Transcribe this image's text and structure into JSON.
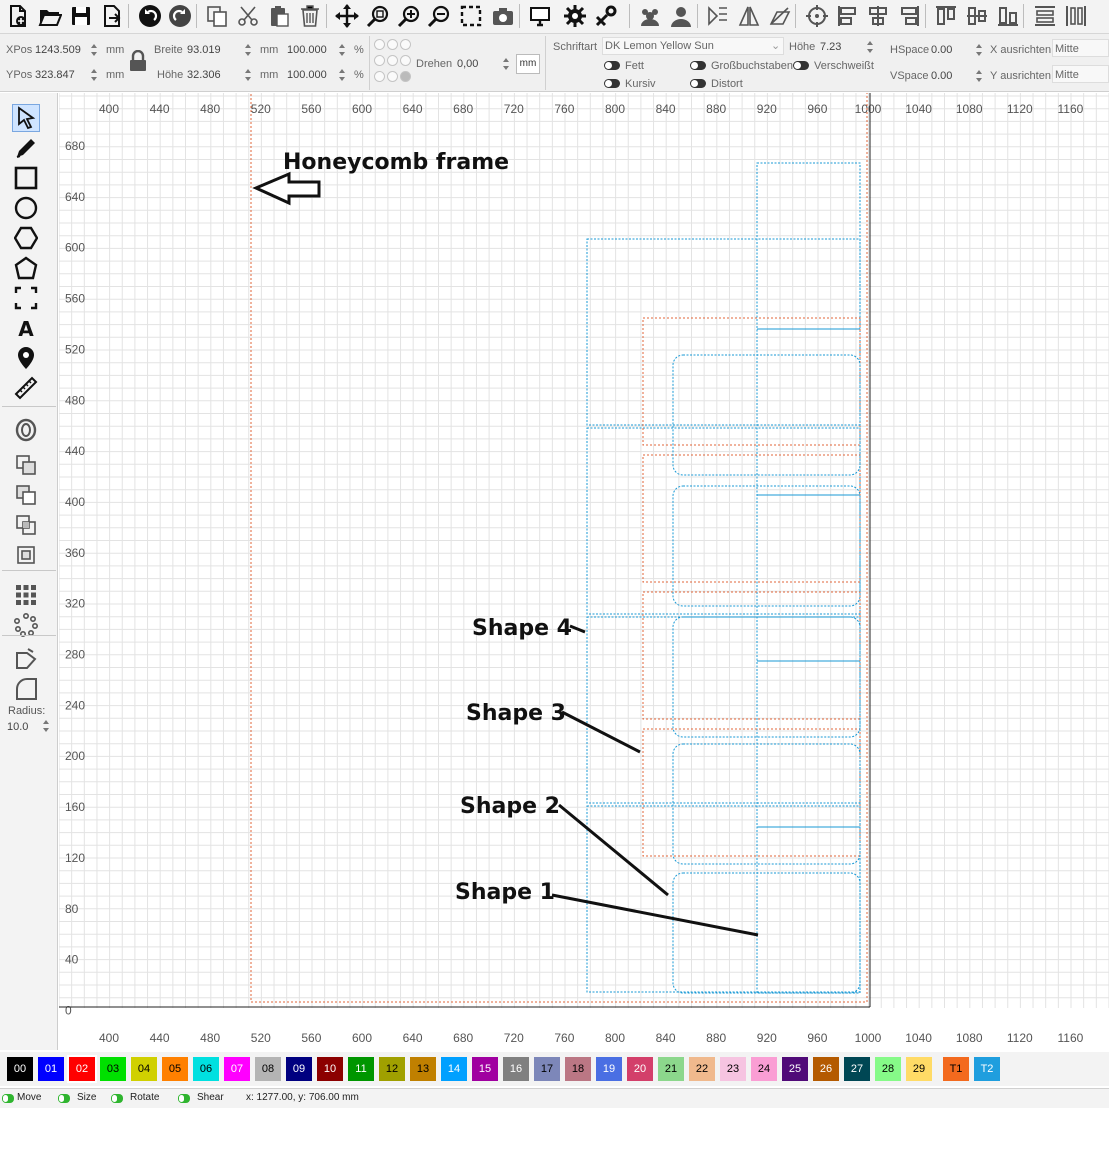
{
  "toolbar": {
    "buttons": [
      {
        "name": "new-file-icon"
      },
      {
        "name": "open-folder-icon"
      },
      {
        "name": "save-icon"
      },
      {
        "name": "export-icon"
      },
      {
        "name": "undo-icon"
      },
      {
        "name": "redo-icon"
      },
      {
        "name": "copy-icon"
      },
      {
        "name": "cut-icon"
      },
      {
        "name": "paste-icon"
      },
      {
        "name": "delete-icon"
      },
      {
        "name": "move-icon"
      },
      {
        "name": "zoom-fit-icon"
      },
      {
        "name": "zoom-in-icon"
      },
      {
        "name": "zoom-out-icon"
      },
      {
        "name": "zoom-selection-icon"
      },
      {
        "name": "camera-icon"
      },
      {
        "name": "monitor-icon"
      },
      {
        "name": "settings-icon"
      },
      {
        "name": "tools-icon"
      },
      {
        "name": "group-icon"
      },
      {
        "name": "ungroup-icon"
      },
      {
        "name": "mirror-horizontal-icon"
      },
      {
        "name": "mirror-vertical-icon"
      },
      {
        "name": "skew-icon"
      },
      {
        "name": "align-center-icon"
      },
      {
        "name": "align-left-icon"
      },
      {
        "name": "align-hcenter-icon"
      },
      {
        "name": "align-right-icon"
      },
      {
        "name": "align-top-icon"
      },
      {
        "name": "align-vcenter-icon"
      },
      {
        "name": "align-bottom-icon"
      },
      {
        "name": "distribute-horizontal-icon"
      },
      {
        "name": "distribute-vertical-icon"
      }
    ]
  },
  "propbar": {
    "xpos_label": "XPos",
    "xpos_value": "1243.509",
    "xpos_unit": "mm",
    "ypos_label": "YPos",
    "ypos_value": "323.847",
    "ypos_unit": "mm",
    "breite_label": "Breite",
    "breite_value": "93.019",
    "breite_unit": "mm",
    "hoehe_label": "Höhe",
    "hoehe_value": "32.306",
    "hoehe_unit": "mm",
    "scale_x_value": "100.000",
    "scale_x_unit": "%",
    "scale_y_value": "100.000",
    "scale_y_unit": "%",
    "rotate_label": "Drehen",
    "rotate_value": "0,00",
    "unit_button": "mm",
    "font_label": "Schriftart",
    "font_value": "DK Lemon Yellow Sun",
    "font_height_label": "Höhe",
    "font_height_value": "7.23",
    "hspace_label": "HSpace",
    "hspace_value": "0.00",
    "vspace_label": "VSpace",
    "vspace_value": "0.00",
    "x_align_label": "X ausrichten",
    "x_align_value": "Mitte",
    "y_align_label": "Y ausrichten",
    "y_align_value": "Mitte",
    "bold_label": "Fett",
    "caps_label": "Großbuchstaben",
    "welded_label": "Verschweißt",
    "italic_label": "Kursiv",
    "distort_label": "Distort"
  },
  "lefttools": {
    "tools": [
      {
        "name": "select-tool-icon"
      },
      {
        "name": "pen-tool-icon"
      },
      {
        "name": "rectangle-tool-icon"
      },
      {
        "name": "ellipse-tool-icon"
      },
      {
        "name": "polygon-tool-icon"
      },
      {
        "name": "pentagon-tool-icon"
      },
      {
        "name": "corner-tool-icon"
      },
      {
        "name": "text-tool-icon"
      },
      {
        "name": "location-pin-icon"
      },
      {
        "name": "measure-tool-icon"
      },
      {
        "name": "offset-tool-icon"
      },
      {
        "name": "boolean-union-icon"
      },
      {
        "name": "boolean-subtract-icon"
      },
      {
        "name": "boolean-intersect-icon"
      },
      {
        "name": "boolean-exclude-icon"
      },
      {
        "name": "array-grid-icon"
      },
      {
        "name": "array-circular-icon"
      },
      {
        "name": "node-edit-icon"
      },
      {
        "name": "corner-radius-icon"
      }
    ],
    "radius_label": "Radius:",
    "radius_value": "10.0"
  },
  "ruler": {
    "x_ticks": [
      "400",
      "440",
      "480",
      "520",
      "560",
      "600",
      "640",
      "680",
      "720",
      "760",
      "800",
      "840",
      "880",
      "920",
      "960",
      "1000",
      "1040",
      "1080",
      "1120",
      "1160"
    ],
    "y_ticks": [
      "680",
      "640",
      "600",
      "560",
      "520",
      "480",
      "440",
      "400",
      "360",
      "320",
      "280",
      "240",
      "200",
      "160",
      "120",
      "80",
      "40",
      "0"
    ]
  },
  "annotations": {
    "frame_label": "Honeycomb frame",
    "shape1": "Shape 1",
    "shape2": "Shape 2",
    "shape3": "Shape 3",
    "shape4": "Shape 4"
  },
  "colors": {
    "shape_blue": "#1a9ad6",
    "shape_red": "#e0663a",
    "grid": "#e3e3e3",
    "palette_selected": "#ff0000"
  },
  "palette": [
    {
      "label": "00",
      "color": "#000000",
      "text": "#ffffff"
    },
    {
      "label": "01",
      "color": "#0000ff",
      "text": "#ffffff"
    },
    {
      "label": "02",
      "color": "#ff0000",
      "text": "#ffffff"
    },
    {
      "label": "03",
      "color": "#00e000",
      "text": "#000000"
    },
    {
      "label": "04",
      "color": "#d0d000",
      "text": "#000000"
    },
    {
      "label": "05",
      "color": "#ff8000",
      "text": "#000000"
    },
    {
      "label": "06",
      "color": "#00e0e0",
      "text": "#000000"
    },
    {
      "label": "07",
      "color": "#ff00ff",
      "text": "#ffffff"
    },
    {
      "label": "08",
      "color": "#b4b4b4",
      "text": "#000000"
    },
    {
      "label": "09",
      "color": "#000080",
      "text": "#ffffff"
    },
    {
      "label": "10",
      "color": "#8c0000",
      "text": "#ffffff"
    },
    {
      "label": "11",
      "color": "#009600",
      "text": "#ffffff"
    },
    {
      "label": "12",
      "color": "#a0a000",
      "text": "#000000"
    },
    {
      "label": "13",
      "color": "#c08000",
      "text": "#000000"
    },
    {
      "label": "14",
      "color": "#00a0ff",
      "text": "#ffffff"
    },
    {
      "label": "15",
      "color": "#a000a0",
      "text": "#ffffff"
    },
    {
      "label": "16",
      "color": "#808080",
      "text": "#ffffff"
    },
    {
      "label": "17",
      "color": "#7d87b9",
      "text": "#000000"
    },
    {
      "label": "18",
      "color": "#bb7784",
      "text": "#000000"
    },
    {
      "label": "19",
      "color": "#4a6fe3",
      "text": "#ffffff"
    },
    {
      "label": "20",
      "color": "#d33f6a",
      "text": "#ffffff"
    },
    {
      "label": "21",
      "color": "#8cd78c",
      "text": "#000000"
    },
    {
      "label": "22",
      "color": "#f0b98d",
      "text": "#000000"
    },
    {
      "label": "23",
      "color": "#f6c4e1",
      "text": "#000000"
    },
    {
      "label": "24",
      "color": "#fa9ed4",
      "text": "#000000"
    },
    {
      "label": "25",
      "color": "#500a78",
      "text": "#ffffff"
    },
    {
      "label": "26",
      "color": "#b45a00",
      "text": "#ffffff"
    },
    {
      "label": "27",
      "color": "#004754",
      "text": "#ffffff"
    },
    {
      "label": "28",
      "color": "#86fa88",
      "text": "#000000"
    },
    {
      "label": "29",
      "color": "#ffdb66",
      "text": "#000000"
    },
    {
      "label": "T1",
      "color": "#f36a1e",
      "text": "#000000"
    },
    {
      "label": "T2",
      "color": "#1f9ede",
      "text": "#ffffff"
    }
  ],
  "statusbar": {
    "move_label": "Move",
    "size_label": "Size",
    "rotate_label": "Rotate",
    "shear_label": "Shear",
    "coords": "x: 1277.00, y: 706.00 mm"
  }
}
